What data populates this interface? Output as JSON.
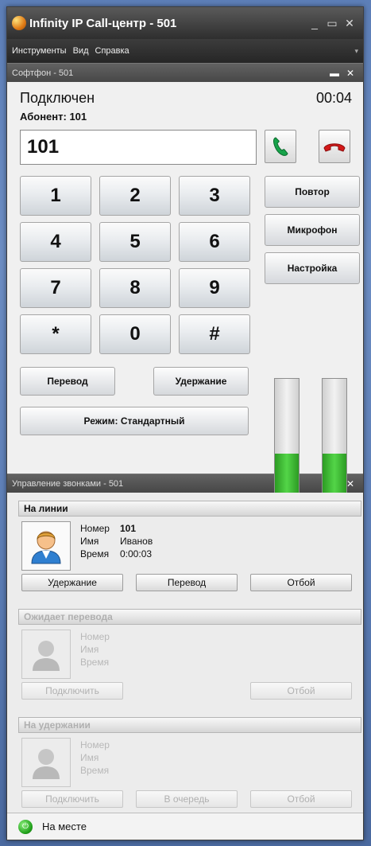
{
  "window": {
    "title": "Infinity IP Call-центр  - 501",
    "menu": [
      "Инструменты",
      "Вид",
      "Справка"
    ]
  },
  "softphone": {
    "panel_title": "Софтфон - 501",
    "status": "Подключен",
    "timer": "00:04",
    "subscriber_label": "Абонент:",
    "subscriber_value": "101",
    "dial_value": "101",
    "keypad": [
      "1",
      "2",
      "3",
      "4",
      "5",
      "6",
      "7",
      "8",
      "9",
      "*",
      "0",
      "#"
    ],
    "side_buttons": {
      "redial": "Повтор",
      "microphone": "Микрофон",
      "settings": "Настройка"
    },
    "transfer_label": "Перевод",
    "hold_label": "Удержание",
    "mode_label": "Режим: Стандартный",
    "meters": {
      "mic_level": 0.48,
      "speaker_level": 0.48
    }
  },
  "call_management": {
    "panel_title": "Управление звонками - 501",
    "on_line": {
      "header": "На линии",
      "number_label": "Номер",
      "number_value": "101",
      "name_label": "Имя",
      "name_value": "Иванов",
      "time_label": "Время",
      "time_value": "0:00:03",
      "hold_btn": "Удержание",
      "transfer_btn": "Перевод",
      "hangup_btn": "Отбой"
    },
    "awaiting_transfer": {
      "header": "Ожидает перевода",
      "number_label": "Номер",
      "name_label": "Имя",
      "time_label": "Время",
      "connect_btn": "Подключить",
      "hangup_btn": "Отбой"
    },
    "on_hold": {
      "header": "На удержании",
      "number_label": "Номер",
      "name_label": "Имя",
      "time_label": "Время",
      "connect_btn": "Подключить",
      "queue_btn": "В очередь",
      "hangup_btn": "Отбой"
    }
  },
  "status_bar": {
    "presence": "На месте"
  }
}
